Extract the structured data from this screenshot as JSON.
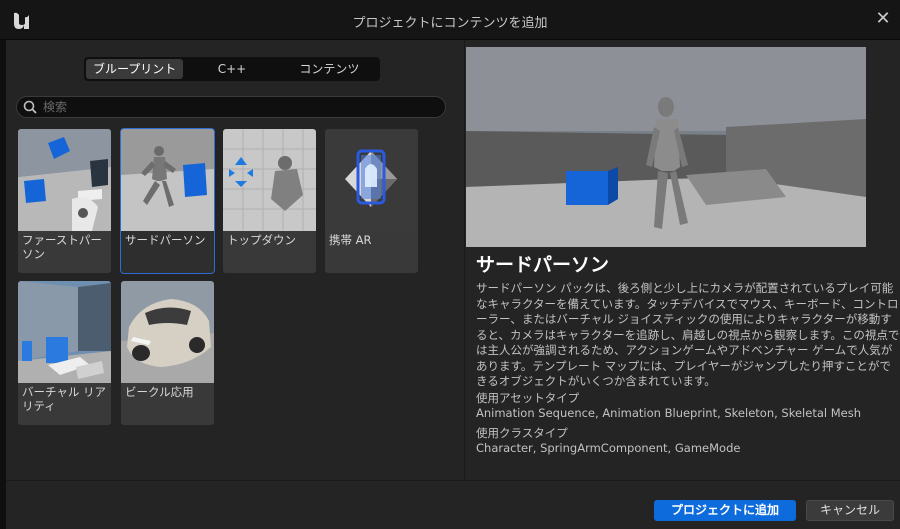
{
  "window": {
    "title": "プロジェクトにコンテンツを追加"
  },
  "tabs": [
    {
      "label": "ブループリント",
      "active": true
    },
    {
      "label": "C++",
      "active": false
    },
    {
      "label": "コンテンツ",
      "active": false
    }
  ],
  "search": {
    "placeholder": "検索",
    "value": ""
  },
  "templates": [
    {
      "label": "ファーストパーソン"
    },
    {
      "label": "サードパーソン",
      "selected": true
    },
    {
      "label": "トップダウン"
    },
    {
      "label": "携帯 AR"
    },
    {
      "label": "バーチャル リアリティ"
    },
    {
      "label": "ビークル応用"
    }
  ],
  "detail": {
    "title": "サードパーソン",
    "description": "サードパーソン パックは、後ろ側と少し上にカメラが配置されているプレイ可能なキャラクターを備えています。タッチデバイスでマウス、キーボード、コントローラー、またはバーチャル ジョイスティックの使用によりキャラクターが移動すると、カメラはキャラクターを追跡し、肩越しの視点から観察します。この視点では主人公が強調されるため、アクションゲームやアドベンチャー ゲームで人気があります。テンプレート マップには、プレイヤーがジャンプしたり押すことができるオブジェクトがいくつか含まれています。",
    "asset_types_label": "使用アセットタイプ",
    "asset_types": "Animation Sequence, Animation Blueprint, Skeleton, Skeletal Mesh",
    "class_types_label": "使用クラスタイプ",
    "class_types": "Character, SpringArmComponent, GameMode"
  },
  "buttons": {
    "add": "プロジェクトに追加",
    "cancel": "キャンセル"
  },
  "colors": {
    "accent": "#0d6bdc",
    "selection": "#2d6ed3",
    "panel": "#242424"
  }
}
